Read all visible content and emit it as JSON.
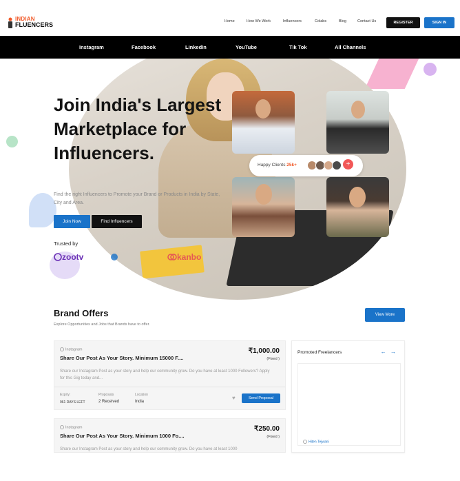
{
  "brand": {
    "line1": "INDIAN",
    "line2": "FLUENCERS"
  },
  "nav": {
    "items": [
      "Home",
      "How We Work",
      "Influencers",
      "Colabs",
      "Blog",
      "Contact Us"
    ],
    "register_label": "REGISTER",
    "signin_label": "SIGN IN"
  },
  "channels": [
    "Instagram",
    "Facebook",
    "LinkedIn",
    "YouTube",
    "Tik Tok",
    "All Channels"
  ],
  "hero": {
    "title": "Join India's Largest Marketplace for Influencers.",
    "subtitle": "Find the right Influencers to Promote your Brand or Products in India by State, City and Area.",
    "join_label": "Join Now",
    "find_label": "Find Influencers",
    "trusted_label": "Trusted by",
    "trusted_brands": [
      "zootv",
      "",
      "kanbo"
    ],
    "happy_label": "Happy Clients",
    "happy_count": "25k+",
    "plus_label": "+"
  },
  "offers": {
    "title": "Brand Offers",
    "subtitle": "Explore Opportunities and Jobs that Brands have to offer.",
    "view_more_label": "View More",
    "cards": [
      {
        "platform": "Instagram",
        "title": "Share Our Post As Your Story. Minimum 15000 F....",
        "price": "₹1,000.00",
        "price_type": "(Fixed )",
        "description": "Share our Instagram Post as your story and help our community grow. Do you have at least 1000 Followers?  Apply for this Gig today and...",
        "expiry_label": "Expiry:",
        "expiry_value": "961 DAYS LEFT",
        "proposals_label": "Proposals",
        "proposals_value": "2 Received",
        "location_label": "Location",
        "location_value": "India",
        "proposal_button": "Send Proposal"
      },
      {
        "platform": "Instagram",
        "title": "Share Our Post As Your Story. Minimum 1000 Fo....",
        "price": "₹250.00",
        "price_type": "(Fixed )",
        "description": "Share our Instagram Post as your story and help our community grow. Do you have at least 1000"
      }
    ]
  },
  "promoted": {
    "title": "Promoted Freelancers",
    "arrows": "← →",
    "freelancer_name": "Hiten Tejwani"
  },
  "colors": {
    "accent": "#1a73c9",
    "brand_orange": "#f15a29",
    "dark": "#111111"
  }
}
